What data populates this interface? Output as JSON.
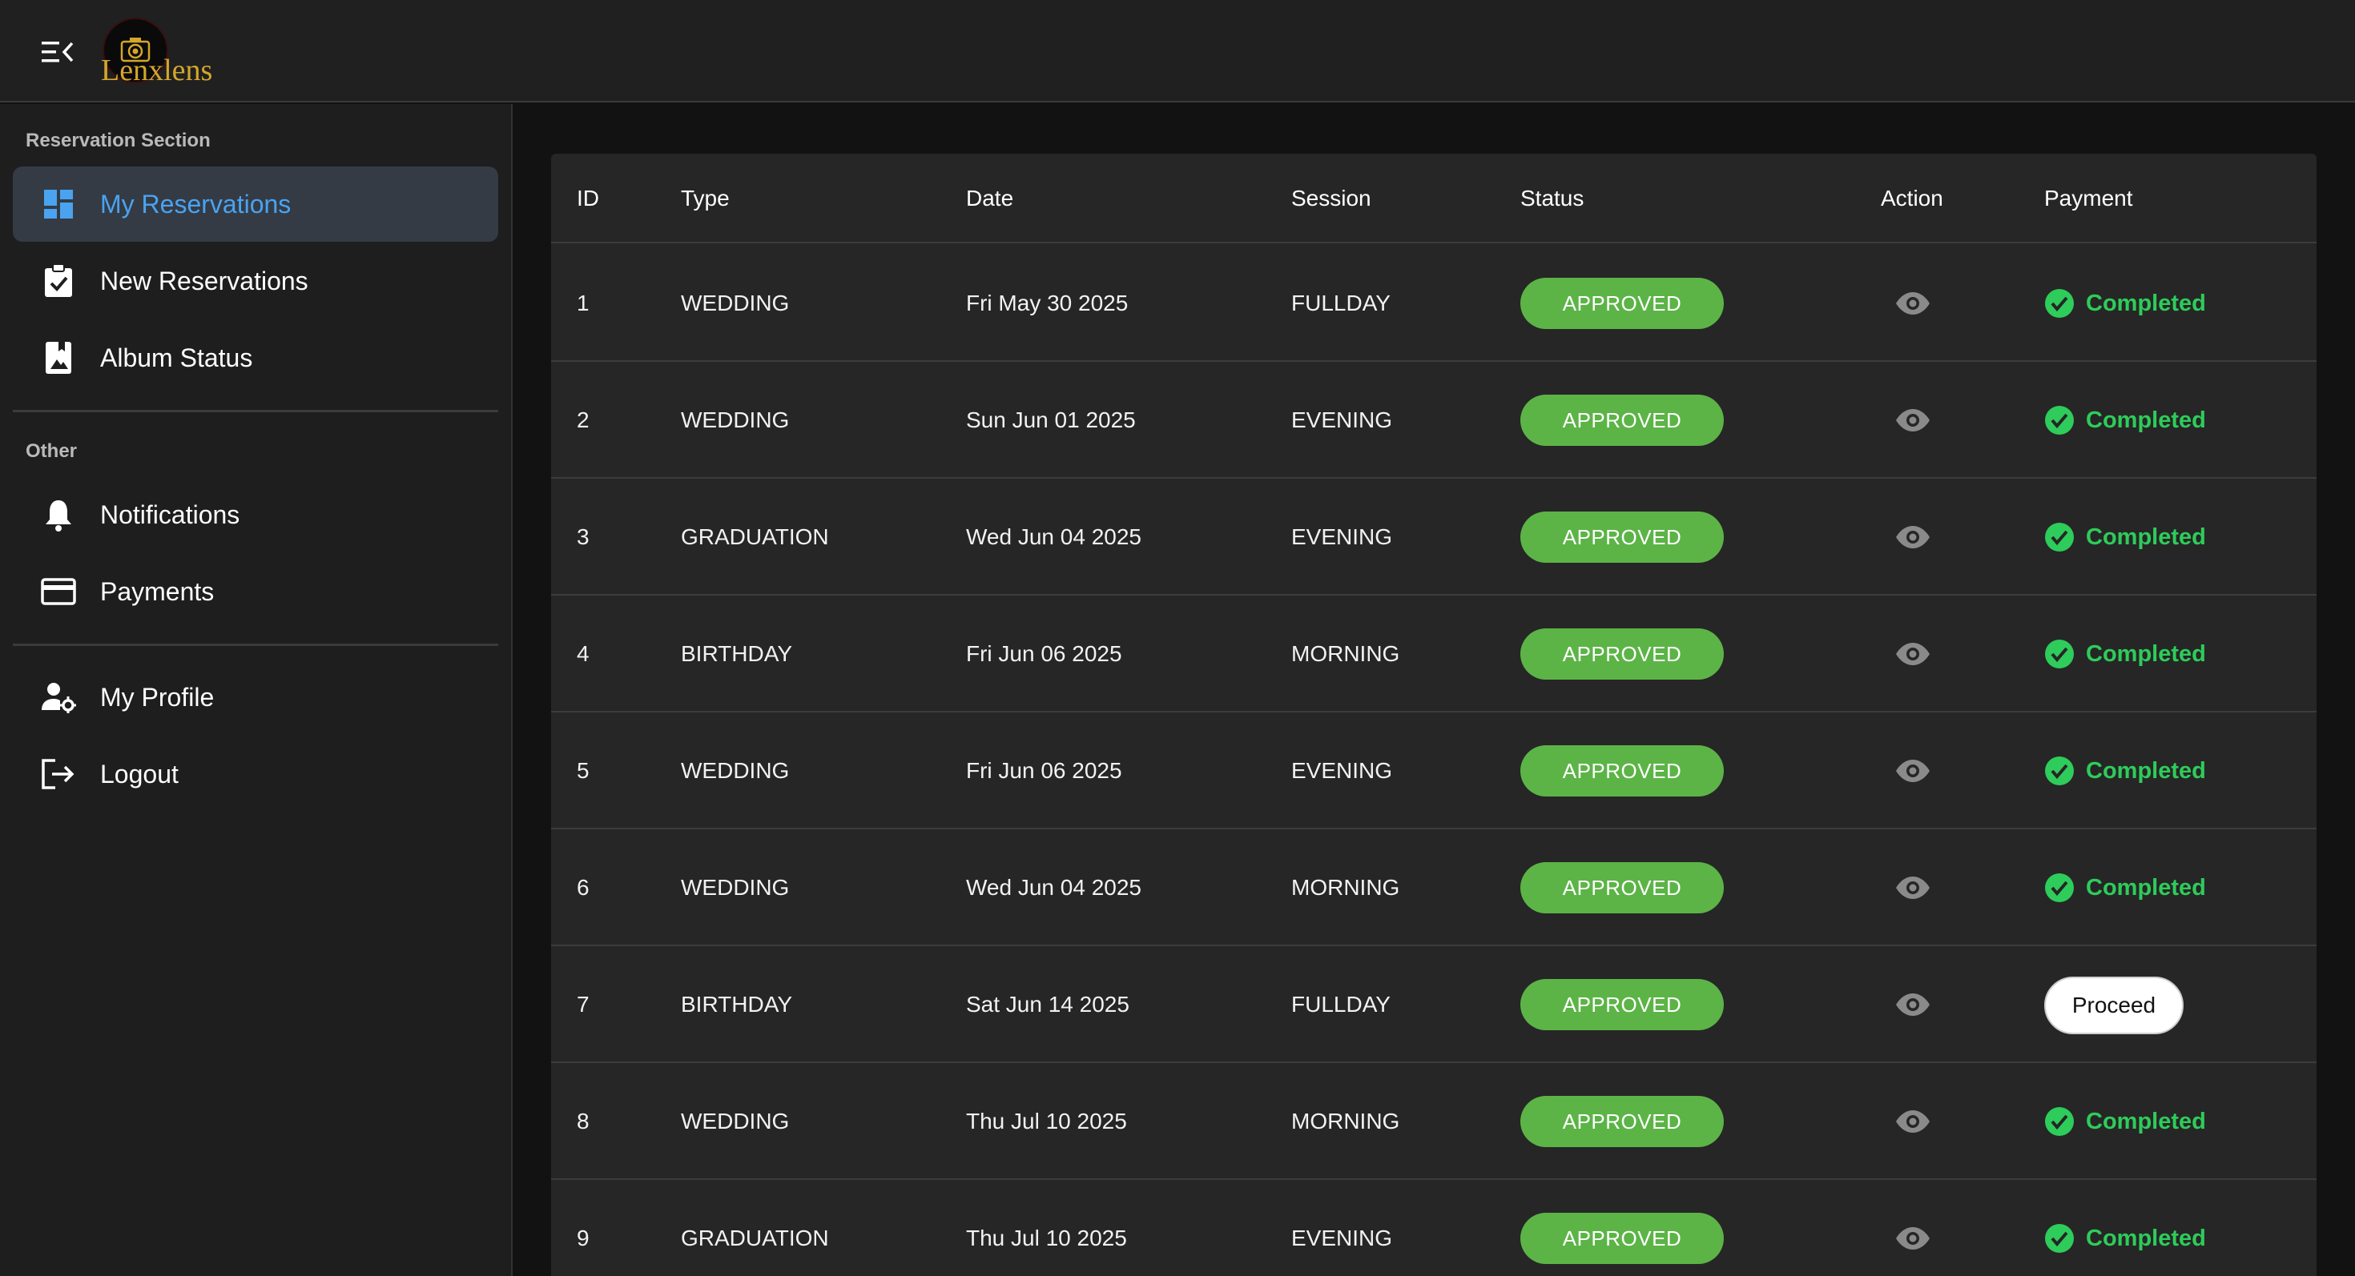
{
  "app": {
    "brand": "Lenxlens"
  },
  "sidebar": {
    "section1_title": "Reservation Section",
    "section2_title": "Other",
    "items": [
      {
        "label": "My Reservations",
        "icon": "dashboard-icon",
        "active": true
      },
      {
        "label": "New Reservations",
        "icon": "clipboard-check-icon"
      },
      {
        "label": "Album Status",
        "icon": "photo-album-icon"
      },
      {
        "label": "Notifications",
        "icon": "bell-icon"
      },
      {
        "label": "Payments",
        "icon": "credit-card-icon"
      },
      {
        "label": "My Profile",
        "icon": "user-settings-icon"
      },
      {
        "label": "Logout",
        "icon": "logout-icon"
      }
    ]
  },
  "table": {
    "headers": [
      "ID",
      "Type",
      "Date",
      "Session",
      "Status",
      "Action",
      "Payment"
    ],
    "rows": [
      {
        "id": "1",
        "type": "WEDDING",
        "date": "Fri May 30 2025",
        "session": "FULLDAY",
        "status": "APPROVED",
        "payment": "Completed"
      },
      {
        "id": "2",
        "type": "WEDDING",
        "date": "Sun Jun 01 2025",
        "session": "EVENING",
        "status": "APPROVED",
        "payment": "Completed"
      },
      {
        "id": "3",
        "type": "GRADUATION",
        "date": "Wed Jun 04 2025",
        "session": "EVENING",
        "status": "APPROVED",
        "payment": "Completed"
      },
      {
        "id": "4",
        "type": "BIRTHDAY",
        "date": "Fri Jun 06 2025",
        "session": "MORNING",
        "status": "APPROVED",
        "payment": "Completed"
      },
      {
        "id": "5",
        "type": "WEDDING",
        "date": "Fri Jun 06 2025",
        "session": "EVENING",
        "status": "APPROVED",
        "payment": "Completed"
      },
      {
        "id": "6",
        "type": "WEDDING",
        "date": "Wed Jun 04 2025",
        "session": "MORNING",
        "status": "APPROVED",
        "payment": "Completed"
      },
      {
        "id": "7",
        "type": "BIRTHDAY",
        "date": "Sat Jun 14 2025",
        "session": "FULLDAY",
        "status": "APPROVED",
        "payment": "Proceed"
      },
      {
        "id": "8",
        "type": "WEDDING",
        "date": "Thu Jul 10 2025",
        "session": "MORNING",
        "status": "APPROVED",
        "payment": "Completed"
      },
      {
        "id": "9",
        "type": "GRADUATION",
        "date": "Thu Jul 10 2025",
        "session": "EVENING",
        "status": "APPROVED",
        "payment": "Completed"
      }
    ]
  },
  "colors": {
    "accent": "#4aa3f0",
    "status_approved": "#5cb447",
    "payment_completed": "#2ecc5a",
    "brand_gold": "#d4a62a"
  }
}
